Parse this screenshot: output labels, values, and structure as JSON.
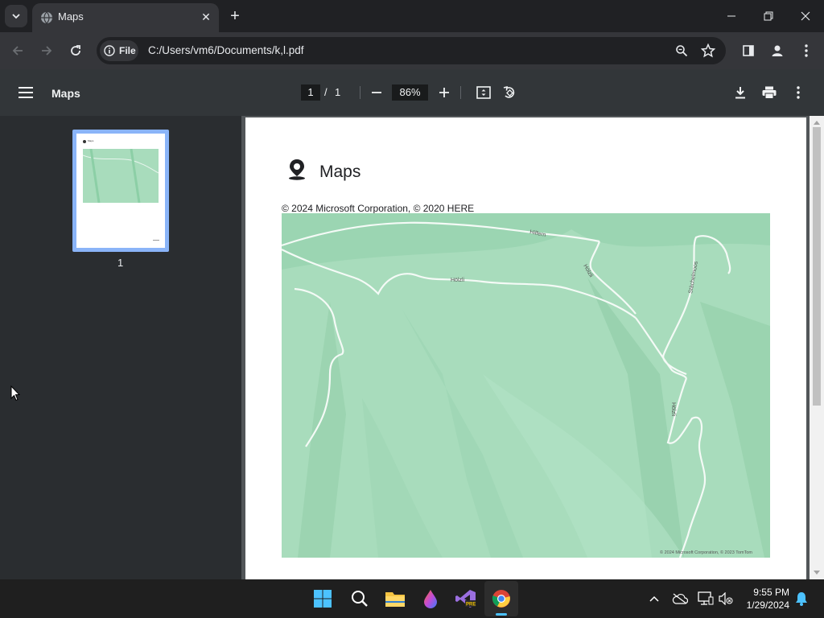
{
  "tab": {
    "title": "Maps",
    "close": "✕",
    "new_tab": "+"
  },
  "toolbar": {
    "chip_label": "File",
    "url": "C:/Users/vm6/Documents/k,l.pdf"
  },
  "pdf": {
    "title": "Maps",
    "current_page": "1",
    "page_sep": "/",
    "total_pages": "1",
    "zoom": "86%"
  },
  "thumbnail": {
    "label": "1",
    "header": "Maps"
  },
  "page": {
    "heading": "Maps",
    "copyright": "© 2024 Microsoft Corporation, © 2020 HERE",
    "map_labels": {
      "road1": "Hilfern",
      "road2": "Hölzli",
      "road3": "Hölzli",
      "road4": "Stächelmoos",
      "road5": "Hölzli",
      "attribution": "© 2024 Microsoft Corporation, © 2023 TomTom"
    }
  },
  "tray": {
    "time": "9:55 PM",
    "date": "1/29/2024"
  },
  "colors": {
    "map_bg": "#a8dcbc",
    "accent": "#8ab4f8",
    "chrome_dark": "#202124",
    "chrome_mid": "#35363a",
    "pdf_bar": "#323639"
  }
}
